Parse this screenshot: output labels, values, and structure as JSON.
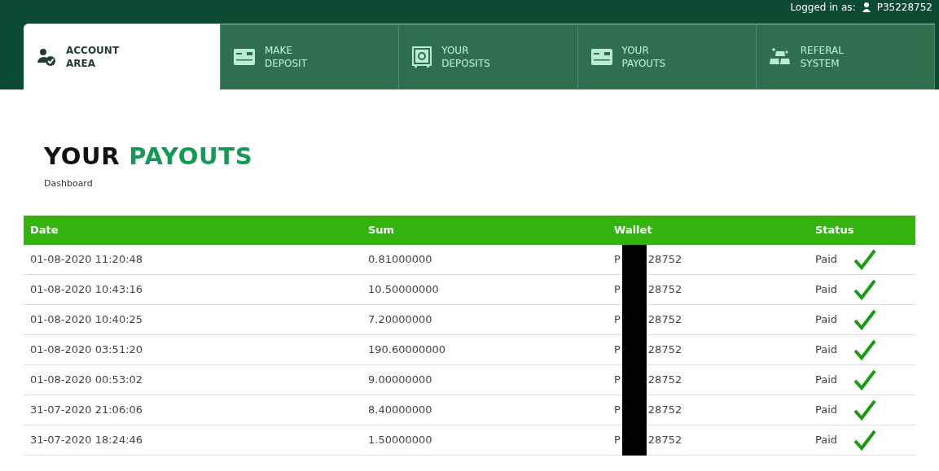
{
  "header": {
    "logged_in_label": "Logged in as:",
    "user": "P35228752"
  },
  "tabs": [
    {
      "kind": "account",
      "line1": "ACCOUNT",
      "line2": "AREA",
      "selected": true
    },
    {
      "kind": "card",
      "line1": "MAKE",
      "line2": "DEPOSIT",
      "selected": false
    },
    {
      "kind": "safe",
      "line1": "YOUR",
      "line2": "DEPOSITS",
      "selected": false
    },
    {
      "kind": "card",
      "line1": "YOUR",
      "line2": "PAYOUTS",
      "selected": false
    },
    {
      "kind": "gold",
      "line1": "REFERAL",
      "line2": "SYSTEM",
      "selected": false
    }
  ],
  "title": {
    "part1": "YOUR",
    "part2": "PAYOUTS"
  },
  "breadcrumb": "Dashboard",
  "table": {
    "columns": [
      "Date",
      "Sum",
      "Wallet",
      "Status"
    ],
    "rows": [
      {
        "date": "01-08-2020 11:20:48",
        "sum": "0.81000000",
        "wallet_start": "P",
        "wallet_end": "28752",
        "status": "Paid",
        "paid": true
      },
      {
        "date": "01-08-2020 10:43:16",
        "sum": "10.50000000",
        "wallet_start": "P",
        "wallet_end": "28752",
        "status": "Paid",
        "paid": true
      },
      {
        "date": "01-08-2020 10:40:25",
        "sum": "7.20000000",
        "wallet_start": "P",
        "wallet_end": "28752",
        "status": "Paid",
        "paid": true
      },
      {
        "date": "01-08-2020 03:51:20",
        "sum": "190.60000000",
        "wallet_start": "P",
        "wallet_end": "28752",
        "status": "Paid",
        "paid": true
      },
      {
        "date": "01-08-2020 00:53:02",
        "sum": "9.00000000",
        "wallet_start": "P",
        "wallet_end": "28752",
        "status": "Paid",
        "paid": true
      },
      {
        "date": "31-07-2020 21:06:06",
        "sum": "8.40000000",
        "wallet_start": "P",
        "wallet_end": "28752",
        "status": "Paid",
        "paid": true
      },
      {
        "date": "31-07-2020 18:24:46",
        "sum": "1.50000000",
        "wallet_start": "P",
        "wallet_end": "28752",
        "status": "Paid",
        "paid": true
      }
    ]
  }
}
